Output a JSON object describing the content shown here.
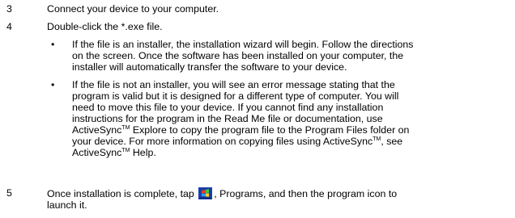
{
  "steps": [
    {
      "number": "3",
      "text": "Connect your device to your computer."
    },
    {
      "number": "4",
      "text": "Double-click the *.exe file."
    },
    {
      "number": "5",
      "text_before": "Once installation is complete, tap",
      "text_after": ", Programs, and then the program icon to",
      "text_line2": "launch it."
    }
  ],
  "bullets": [
    {
      "symbol": "•",
      "lines": [
        "If the file is an installer, the installation wizard will begin. Follow the directions",
        "on the screen. Once the software has been installed on your computer, the",
        "installer will automatically transfer the software to your device."
      ]
    },
    {
      "symbol": "•",
      "lines": [
        "If the file is not an installer, you will see an error message stating that the",
        "program is valid but it is designed for a different type of computer. You will",
        "need to move this file to your device. If you cannot find any installation",
        "instructions for the program in the Read Me file or documentation, use"
      ],
      "line5_a": "ActiveSync",
      "line5_b": " Explore to copy the program file to the Program Files folder on",
      "line6_a": "your device. For more information on copying files using ActiveSync",
      "line6_b": ", see",
      "line7_a": "ActiveSync",
      "line7_b": " Help.",
      "tm": "TM"
    }
  ],
  "icons": {
    "start_icon": "windows-start-flag-icon"
  }
}
